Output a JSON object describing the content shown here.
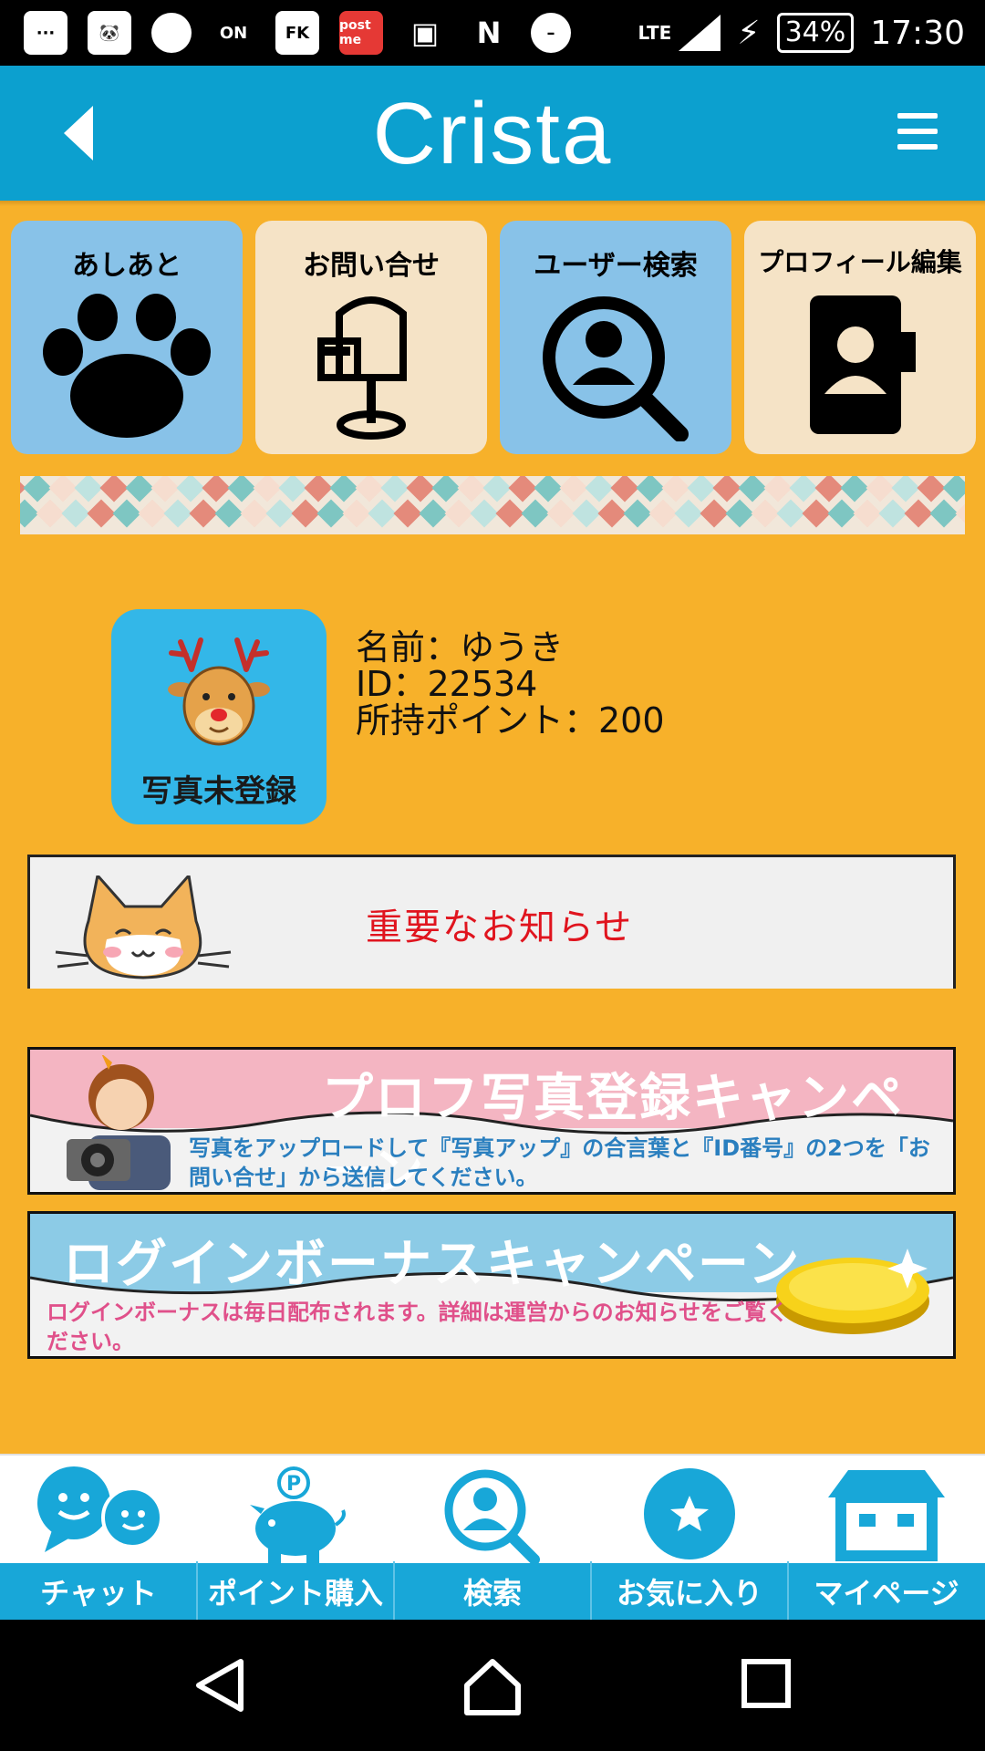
{
  "status_bar": {
    "time": "17:30",
    "battery": "34%",
    "network": "LTE",
    "notification_icons": [
      "···",
      "🐼",
      "●",
      "ON",
      "FK",
      "post me",
      "▣",
      "N",
      "–"
    ]
  },
  "header": {
    "title": "Crista"
  },
  "tiles": [
    {
      "label": "あしあと",
      "icon": "paw-icon"
    },
    {
      "label": "お問い合せ",
      "icon": "mailbox-icon"
    },
    {
      "label": "ユーザー検索",
      "icon": "user-search-icon"
    },
    {
      "label": "プロフィール編集",
      "icon": "profile-book-icon"
    }
  ],
  "profile": {
    "photo_label": "写真未登録",
    "name_line": "名前：ゆうき",
    "id_line": "ID：22534",
    "points_line": "所持ポイント：200"
  },
  "notice": {
    "label": "重要なお知らせ"
  },
  "banners": [
    {
      "title": "プロフ写真登録キャンペーン",
      "text": "写真をアップロードして『写真アップ』の合言葉と『ID番号』の2つを「お問い合せ」から送信してください。"
    },
    {
      "title": "ログインボーナスキャンペーン",
      "text": "ログインボーナスは毎日配布されます。詳細は運営からのお知らせをご覧ください。"
    }
  ],
  "bottom_nav": [
    {
      "label": "チャット",
      "icon": "chat-icon"
    },
    {
      "label": "ポイント購入",
      "icon": "piggy-bank-icon"
    },
    {
      "label": "検索",
      "icon": "search-icon"
    },
    {
      "label": "お気に入り",
      "icon": "star-icon"
    },
    {
      "label": "マイページ",
      "icon": "home-icon"
    }
  ],
  "colors": {
    "header": "#0ca0cf",
    "background": "#f7b12a",
    "nav_strip": "#18a7d8",
    "notice_text": "#e0141e"
  }
}
